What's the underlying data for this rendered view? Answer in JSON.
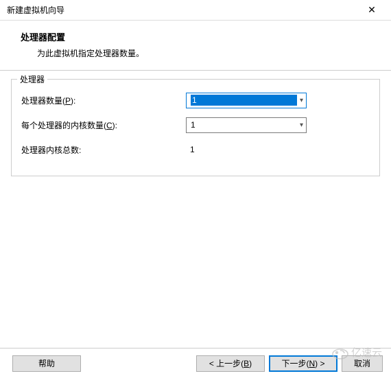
{
  "window": {
    "title": "新建虚拟机向导",
    "close_icon": "✕"
  },
  "header": {
    "heading": "处理器配置",
    "subtext": "为此虚拟机指定处理器数量。"
  },
  "group": {
    "legend": "处理器",
    "rows": {
      "procCount": {
        "label_prefix": "处理器数量(",
        "label_hotkey": "P",
        "label_suffix": "):",
        "value": "1"
      },
      "coresPerProc": {
        "label_prefix": "每个处理器的内核数量(",
        "label_hotkey": "C",
        "label_suffix": "):",
        "value": "1"
      },
      "totalCores": {
        "label": "处理器内核总数:",
        "value": "1"
      }
    }
  },
  "buttons": {
    "help": "帮助",
    "back_prefix": "< 上一步(",
    "back_hotkey": "B",
    "back_suffix": ")",
    "next_prefix": "下一步(",
    "next_hotkey": "N",
    "next_suffix": ") >",
    "cancel": "取消"
  },
  "watermark": "亿速云"
}
